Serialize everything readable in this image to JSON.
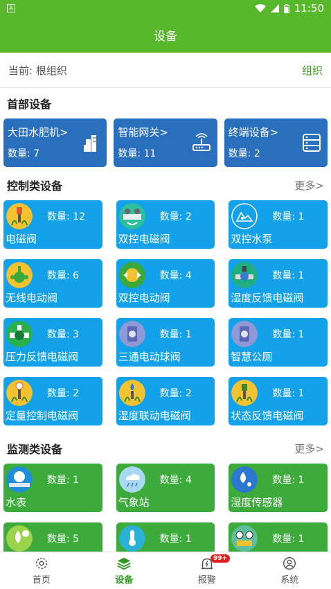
{
  "status_bar": {
    "time": "11:50",
    "left_icon": "A"
  },
  "app_bar": {
    "title": "设备"
  },
  "crumb": {
    "current": "当前: 根组织",
    "org_button": "组织"
  },
  "head_section": {
    "title": "首部设备",
    "cards": [
      {
        "label": "大田水肥机>",
        "count": "数量: 7",
        "icon": "building-icon"
      },
      {
        "label": "智能网关>",
        "count": "数量: 11",
        "icon": "router-icon"
      },
      {
        "label": "终端设备>",
        "count": "数量: 2",
        "icon": "server-icon"
      }
    ]
  },
  "control_section": {
    "title": "控制类设备",
    "more": "更多>",
    "items": [
      {
        "name": "电磁阀",
        "count": "数量: 12",
        "icon": "solenoid-valve-icon"
      },
      {
        "name": "双控电磁阀",
        "count": "数量: 2",
        "icon": "dual-solenoid-icon"
      },
      {
        "name": "双控水泵",
        "count": "数量: 1",
        "icon": "pump-icon"
      },
      {
        "name": "无线电动阀",
        "count": "数量: 6",
        "icon": "wireless-valve-icon"
      },
      {
        "name": "双控电动阀",
        "count": "数量: 4",
        "icon": "dual-electric-valve-icon"
      },
      {
        "name": "湿度反馈电磁阀",
        "count": "数量: 1",
        "icon": "humidity-valve-icon"
      },
      {
        "name": "压力反馈电磁阀",
        "count": "数量: 3",
        "icon": "pressure-valve-icon"
      },
      {
        "name": "三通电动球阀",
        "count": "数量: 1",
        "icon": "ball-valve-icon"
      },
      {
        "name": "智慧公厕",
        "count": "数量: 1",
        "icon": "toilet-icon"
      },
      {
        "name": "定量控制电磁阀",
        "count": "数量: 2",
        "icon": "quantitative-valve-icon"
      },
      {
        "name": "湿度联动电磁阀",
        "count": "数量: 2",
        "icon": "humidity-link-valve-icon"
      },
      {
        "name": "状态反馈电磁阀",
        "count": "数量: 1",
        "icon": "status-valve-icon"
      }
    ]
  },
  "monitor_section": {
    "title": "监测类设备",
    "more": "更多>",
    "items": [
      {
        "name": "水表",
        "count": "数量: 1",
        "icon": "water-meter-icon"
      },
      {
        "name": "气象站",
        "count": "数量: 4",
        "icon": "weather-station-icon"
      },
      {
        "name": "湿度传感器",
        "count": "数量: 1",
        "icon": "humidity-sensor-icon"
      },
      {
        "name": "",
        "count": "数量: 5",
        "icon": "ec-sensor-icon"
      },
      {
        "name": "",
        "count": "数量: 1",
        "icon": "temperature-sensor-icon"
      },
      {
        "name": "",
        "count": "数量: 1",
        "icon": "pressure-gauge-icon"
      }
    ]
  },
  "nav": {
    "items": [
      {
        "label": "首页",
        "icon": "gear-icon"
      },
      {
        "label": "设备",
        "icon": "layers-icon"
      },
      {
        "label": "报警",
        "icon": "alarm-icon",
        "badge": "99+"
      },
      {
        "label": "系统",
        "icon": "user-icon"
      }
    ]
  },
  "colors": {
    "primary_green": "#58b82c",
    "head_card": "#2a6fbd",
    "control_card": "#13a2ea",
    "monitor_card": "#3cab3c"
  }
}
